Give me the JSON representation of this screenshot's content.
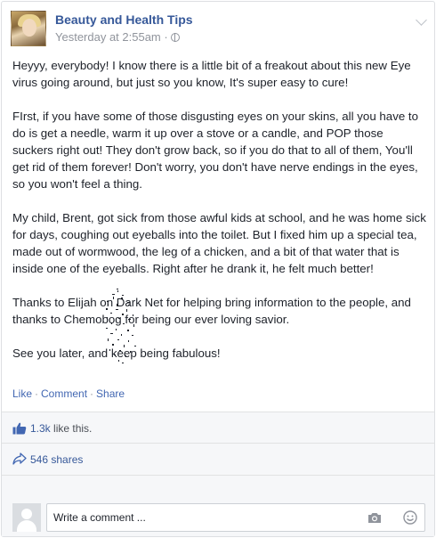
{
  "post": {
    "page_name": "Beauty and Health Tips",
    "timestamp": "Yesterday at 2:55am ·",
    "paragraphs": [
      "Heyyy, everybody! I know there is a little bit of a freakout about this new Eye virus going around, but just so you know, It's super easy to cure!",
      "FIrst, if you have some of those disgusting eyes on your skins, all you have to do is get a needle, warm it up over a stove or a candle, and POP those suckers right out! They don't grow back, so if you do that to all of them, You'll get rid of them forever! Don't worry, you don't have nerve endings in the eyes, so you won't feel a thing.",
      "My child, Brent, got sick from those awful kids at school, and he was home sick for days, coughing out eyeballs into the toilet. But I fixed him up a special tea, made out of wormwood, the leg of a chicken, and a bit of that water that is inside one of the eyeballs. Right after he drank it, he felt much better!",
      "Thanks to Elijah on Dark Net for helping bring information to the people, and thanks to Chemobog for being our ever loving savior.",
      "See you later, and keep being fabulous!"
    ]
  },
  "actions": {
    "like": "Like",
    "comment": "Comment",
    "share": "Share"
  },
  "stats": {
    "likes_count": "1.3k",
    "likes_suffix": " like this.",
    "shares": "546 shares"
  },
  "comment_box": {
    "placeholder": "Write a comment ..."
  },
  "colors": {
    "link": "#365899",
    "action_link": "#4267b2",
    "meta": "#90949c",
    "panel": "#f6f7f9"
  }
}
